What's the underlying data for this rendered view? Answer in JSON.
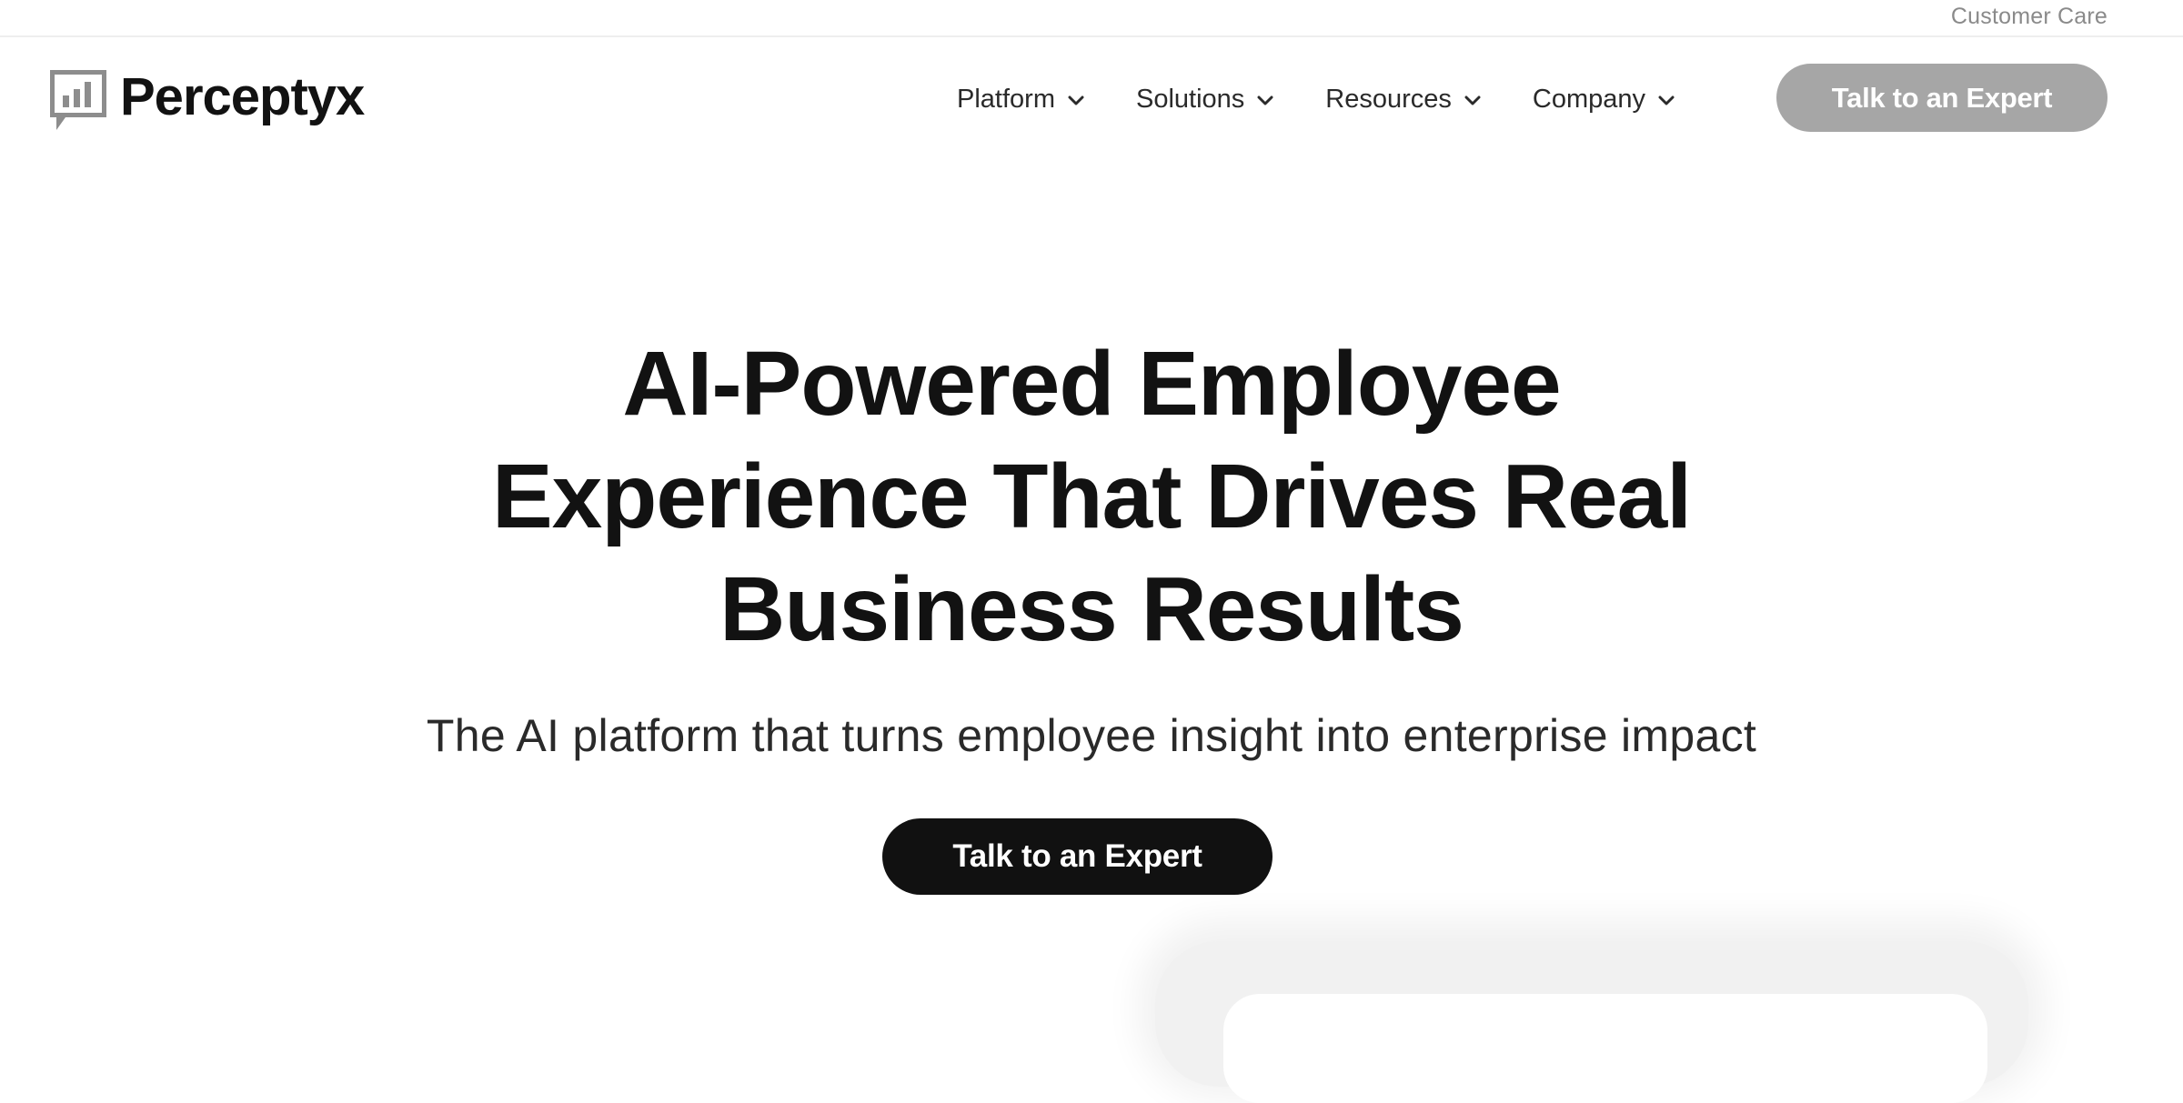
{
  "utility": {
    "customer_care": "Customer Care"
  },
  "brand": {
    "name": "Perceptyx",
    "logo_icon": "chat-bubble-bar-chart-icon"
  },
  "nav": {
    "items": [
      {
        "label": "Platform",
        "icon": "chevron-down-icon"
      },
      {
        "label": "Solutions",
        "icon": "chevron-down-icon"
      },
      {
        "label": "Resources",
        "icon": "chevron-down-icon"
      },
      {
        "label": "Company",
        "icon": "chevron-down-icon"
      }
    ],
    "cta_label": "Talk to an Expert"
  },
  "hero": {
    "title_lines": [
      "AI-Powered Employee",
      "Experience That Drives Real",
      "Business Results"
    ],
    "subtitle": "The AI platform that turns employee insight into enterprise impact",
    "cta_label": "Talk to an Expert"
  },
  "colors": {
    "header_cta_bg": "#a6a6a6",
    "hero_cta_bg": "#111111",
    "text_primary": "#121212",
    "text_muted": "#8a8a8a"
  }
}
